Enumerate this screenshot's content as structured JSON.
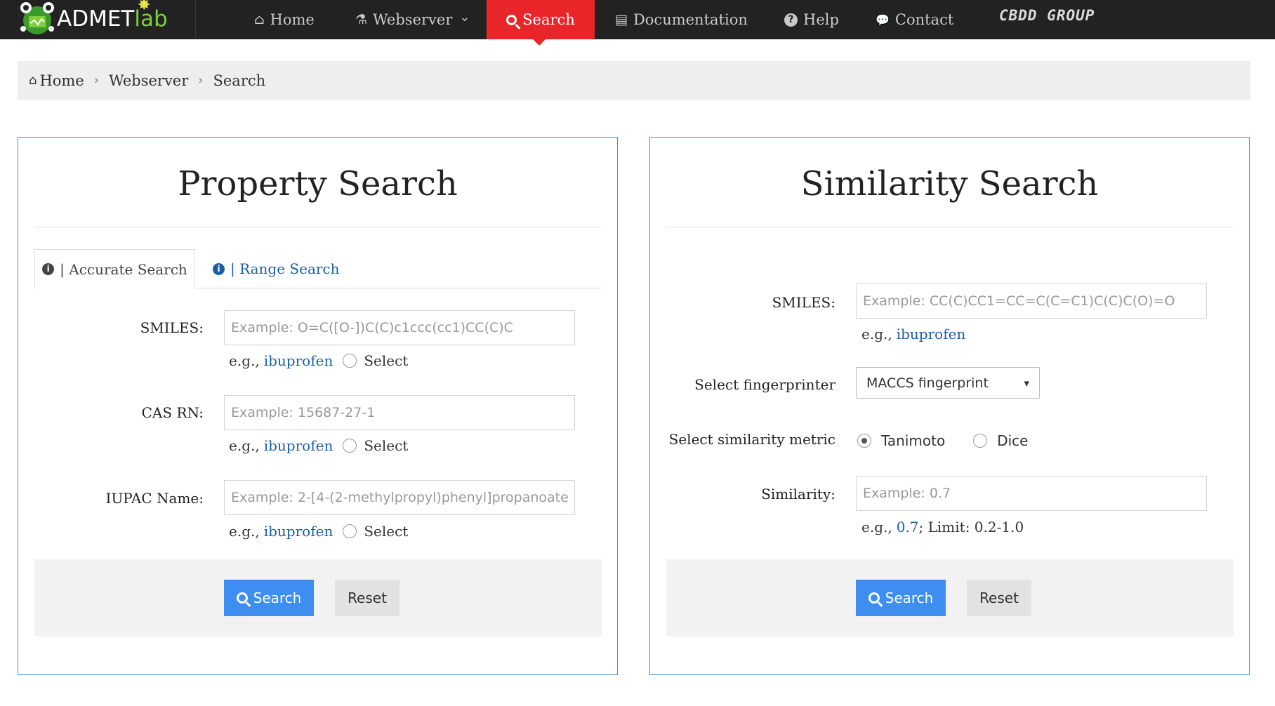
{
  "brand": {
    "name_main": "ADMET",
    "name_lab": "lab"
  },
  "nav": {
    "items": [
      {
        "label": "Home",
        "icon": "home-icon",
        "glyph": "⌂"
      },
      {
        "label": "Webserver",
        "icon": "flask-icon",
        "glyph": "⚗",
        "caret": "⌄"
      },
      {
        "label": "Search",
        "icon": "search-icon"
      },
      {
        "label": "Documentation",
        "icon": "book-icon",
        "glyph": "▤"
      },
      {
        "label": "Help",
        "icon": "question-icon",
        "glyph": "?"
      },
      {
        "label": "Contact",
        "icon": "chat-icon",
        "glyph": "💬"
      }
    ],
    "group_logo": "CBDD GROUP"
  },
  "breadcrumb": {
    "home": "Home",
    "webserver": "Webserver",
    "current": "Search",
    "home_glyph": "⌂",
    "sep": "›"
  },
  "property": {
    "title": "Property Search",
    "tab_accurate": "| Accurate Search",
    "tab_range": "| Range Search",
    "smiles_label": "SMILES:",
    "smiles_placeholder": "Example: O=C([O-])C(C)c1ccc(cc1)CC(C)C",
    "cas_label": "CAS RN:",
    "cas_placeholder": "Example: 15687-27-1",
    "iupac_label": "IUPAC Name:",
    "iupac_placeholder": "Example: 2-[4-(2-methylpropyl)phenyl]propanoate",
    "eg": "e.g.,",
    "example_link": "ibuprofen",
    "select_label": "Select",
    "search_btn": "Search",
    "reset_btn": "Reset"
  },
  "similarity": {
    "title": "Similarity Search",
    "smiles_label": "SMILES:",
    "smiles_placeholder": "Example: CC(C)CC1=CC=C(C=C1)C(C)C(O)=O",
    "eg": "e.g.,",
    "example_link": "ibuprofen",
    "fingerprinter_label": "Select fingerprinter",
    "fingerprinter_value": "MACCS fingerprint",
    "metric_label": "Select similarity metric",
    "metric_tanimoto": "Tanimoto",
    "metric_dice": "Dice",
    "similarity_label": "Similarity:",
    "similarity_placeholder": "Example: 0.7",
    "sim_example": "0.7",
    "sim_limit": "; Limit: 0.2-1.0",
    "search_btn": "Search",
    "reset_btn": "Reset"
  },
  "colors": {
    "nav_bg": "#222222",
    "active": "#e8262a",
    "primary": "#3d8ef0",
    "link": "#1a5fa6",
    "panel_border": "#4a90c8"
  }
}
